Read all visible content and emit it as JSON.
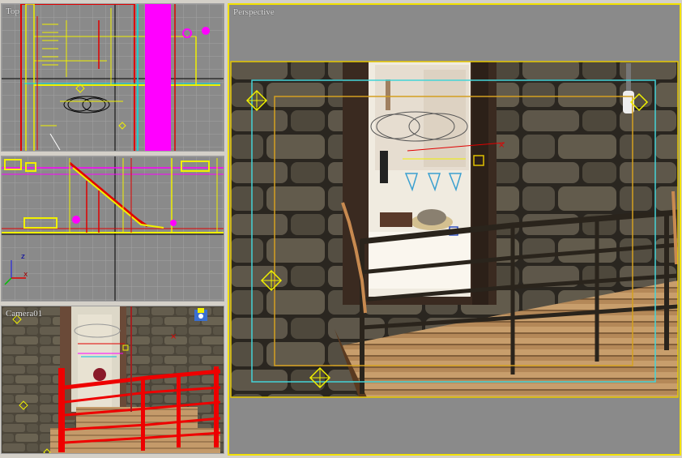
{
  "viewports": {
    "top": {
      "label": "Top"
    },
    "front": {
      "label": ""
    },
    "camera": {
      "label": "Camera01"
    },
    "perspective": {
      "label": "Perspective"
    }
  },
  "axis_tripod": {
    "z_label": "z",
    "x_label": "x"
  },
  "colors": {
    "viewport_bg": "#8a8a8a",
    "grid": "#a2a2a2",
    "active_border": "#f2e100",
    "wire_yellow": "#f0f000",
    "wire_magenta": "#ff00ff",
    "wire_red": "#e00000",
    "wire_cyan": "#00e0e0",
    "safe_frame_outer": "#44d4d8",
    "safe_frame_inner": "#d4a020",
    "stone_dark": "#3a352c",
    "wood": "#c49a6a"
  },
  "icons": {
    "light": "light-helper-icon",
    "camera": "camera-helper-icon"
  }
}
